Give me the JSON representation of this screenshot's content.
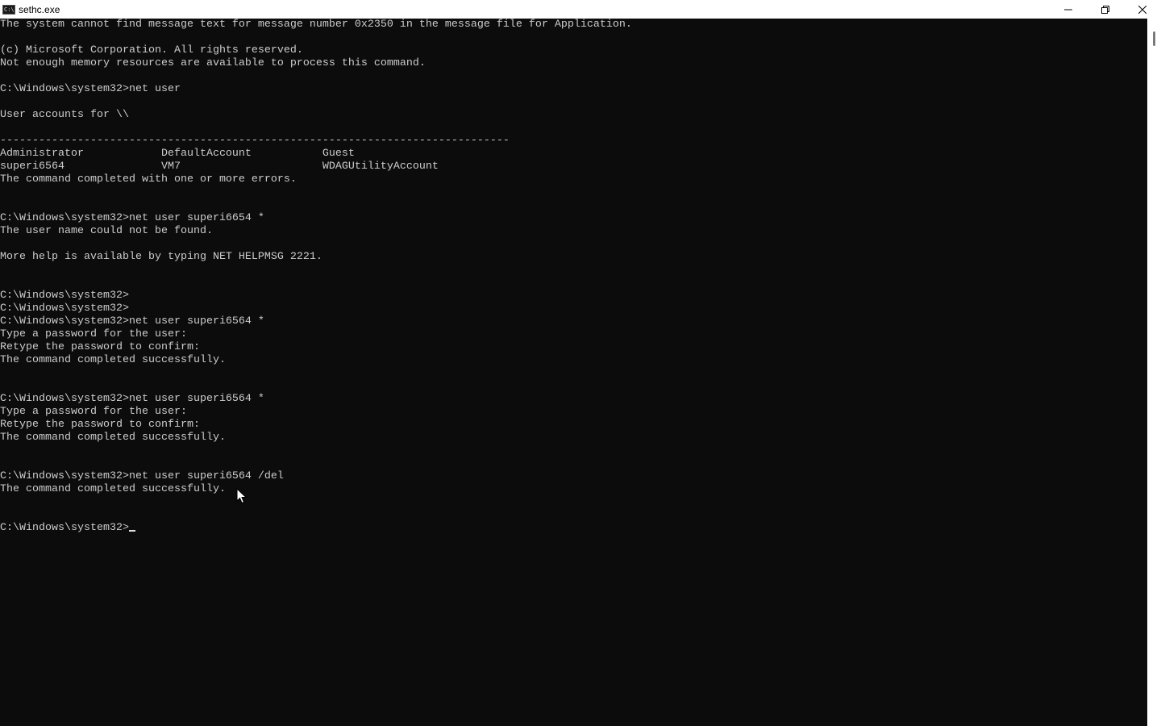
{
  "window": {
    "title": "sethc.exe",
    "app_icon_glyph": "C:\\",
    "controls": {
      "minimize_icon": "minimize-icon",
      "maximize_icon": "restore-icon",
      "close_icon": "close-icon"
    }
  },
  "console": {
    "lines": [
      "The system cannot find message text for message number 0x2350 in the message file for Application.",
      "",
      "(c) Microsoft Corporation. All rights reserved.",
      "Not enough memory resources are available to process this command.",
      "",
      "C:\\Windows\\system32>net user",
      "",
      "User accounts for \\\\",
      "",
      "-------------------------------------------------------------------------------",
      "Administrator            DefaultAccount           Guest",
      "superi6564               VM7                      WDAGUtilityAccount",
      "The command completed with one or more errors.",
      "",
      "",
      "C:\\Windows\\system32>net user superi6654 *",
      "The user name could not be found.",
      "",
      "More help is available by typing NET HELPMSG 2221.",
      "",
      "",
      "C:\\Windows\\system32>",
      "C:\\Windows\\system32>",
      "C:\\Windows\\system32>net user superi6564 *",
      "Type a password for the user:",
      "Retype the password to confirm:",
      "The command completed successfully.",
      "",
      "",
      "C:\\Windows\\system32>net user superi6564 *",
      "Type a password for the user:",
      "Retype the password to confirm:",
      "The command completed successfully.",
      "",
      "",
      "C:\\Windows\\system32>net user superi6564 /del",
      "The command completed successfully.",
      "",
      "",
      "C:\\Windows\\system32>"
    ]
  },
  "colors": {
    "console_background": "#0c0c0c",
    "console_text": "#cccccc",
    "titlebar": "#ffffff"
  }
}
